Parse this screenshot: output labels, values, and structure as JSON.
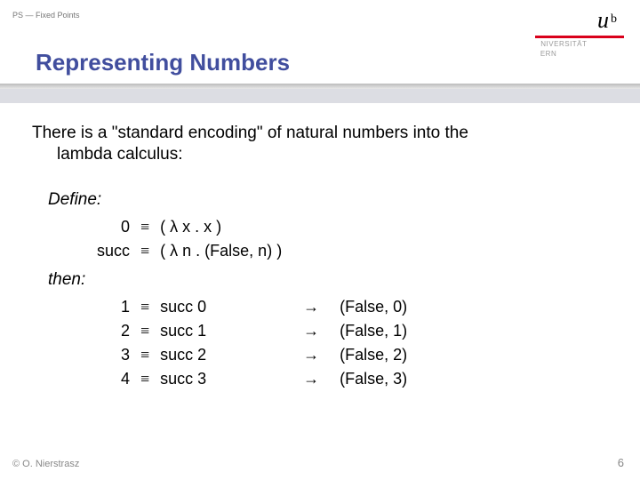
{
  "header": {
    "course": "PS — Fixed Points"
  },
  "logo": {
    "letter1": "u",
    "letter2": "b",
    "line1": "UNIVERSITÄT",
    "line2": "BERN"
  },
  "title": "Representing Numbers",
  "intro": {
    "line1": "There is a \"standard encoding\" of natural numbers into the",
    "line2": "lambda calculus:"
  },
  "sections": {
    "define": "Define:",
    "then": "then:"
  },
  "symbols": {
    "equiv": "≡",
    "arrow": "→",
    "lambda": "λ"
  },
  "defs": [
    {
      "lhs": "0",
      "rhs_pre": "( ",
      "rhs_mid": " x . x )"
    },
    {
      "lhs": "succ",
      "rhs_pre": "( ",
      "rhs_mid": " n . (False, n) )"
    }
  ],
  "rows": [
    {
      "lhs": "1",
      "mid": "succ 0",
      "res": "(False, 0)"
    },
    {
      "lhs": "2",
      "mid": "succ 1",
      "res": "(False, 1)"
    },
    {
      "lhs": "3",
      "mid": "succ 2",
      "res": "(False, 2)"
    },
    {
      "lhs": "4",
      "mid": "succ 3",
      "res": "(False, 3)"
    }
  ],
  "footer": {
    "left": "© O. Nierstrasz",
    "right": "6"
  }
}
